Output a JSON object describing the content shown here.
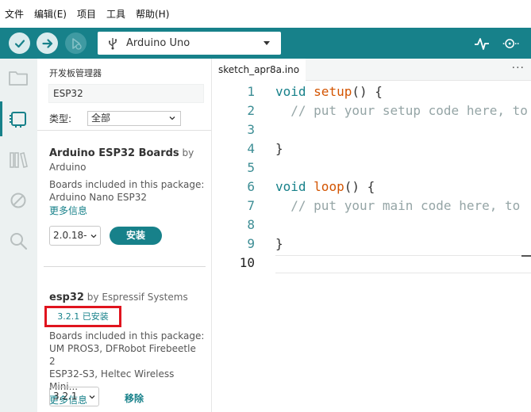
{
  "menu": [
    "文件",
    "编辑(E)",
    "项目",
    "工具",
    "帮助(H)"
  ],
  "toolbar": {
    "board": "Arduino Uno"
  },
  "boards_manager": {
    "title": "开发板管理器",
    "search_value": "ESP32",
    "type_label": "类型:",
    "type_value": "全部",
    "packages": [
      {
        "name": "Arduino ESP32 Boards",
        "by_word": "by",
        "author": "Arduino",
        "desc_line1": "Boards included in this package:",
        "desc_line2": "Arduino Nano ESP32",
        "more": "更多信息",
        "version": "2.0.18-",
        "action": "安装"
      },
      {
        "name": "esp32",
        "by_word": "by",
        "author": "Espressif Systems",
        "installed_badge": "3.2.1 已安装",
        "desc_line1": "Boards included in this package:",
        "desc_line2": "UM PROS3, DFRobot Firebeetle 2",
        "desc_line3": "ESP32-S3, Heltec Wireless Mini...",
        "more": "更多信息",
        "version": "3.2.1",
        "action": "移除"
      }
    ]
  },
  "editor": {
    "tab": "sketch_apr8a.ino",
    "more": "···",
    "line_numbers": [
      "1",
      "2",
      "3",
      "4",
      "5",
      "6",
      "7",
      "8",
      "9",
      "10"
    ],
    "lines": {
      "l1_kw": "void",
      "l1_fn": "setup",
      "l1_rest": "() {",
      "l2": "  // put your setup code here, to",
      "l4": "}",
      "l6_kw": "void",
      "l6_fn": "loop",
      "l6_rest": "() {",
      "l7": "  // put your main code here, to",
      "l9": "}"
    }
  }
}
